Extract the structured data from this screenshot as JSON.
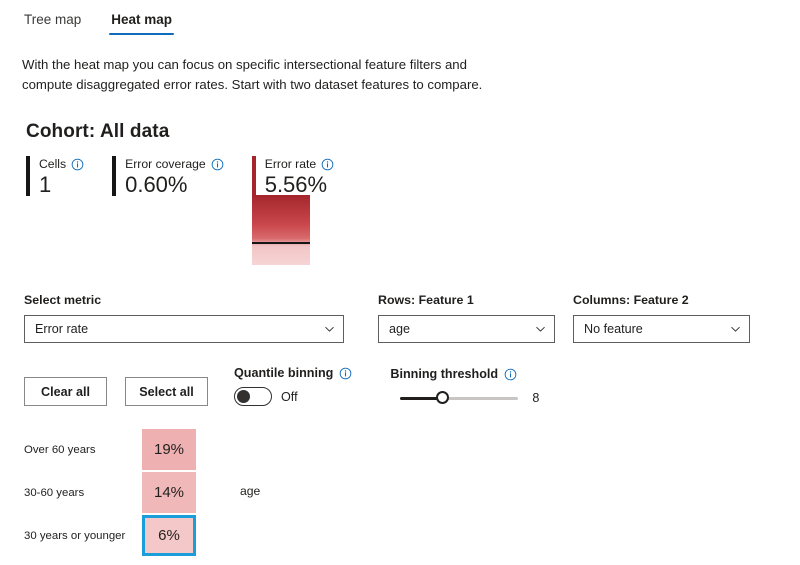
{
  "tabs": [
    {
      "label": "Tree map",
      "active": false
    },
    {
      "label": "Heat map",
      "active": true
    }
  ],
  "description": "With the heat map you can focus on specific intersectional feature filters and compute disaggregated error rates. Start with two dataset features to compare.",
  "cohort": {
    "title": "Cohort: All data",
    "stats": [
      {
        "label": "Cells",
        "value": "1",
        "accent": "#161616",
        "info_icon": "info-icon"
      },
      {
        "label": "Error coverage",
        "value": "0.60%",
        "accent": "#161616",
        "info_icon": "info-icon"
      },
      {
        "label": "Error rate",
        "value": "5.56%",
        "accent": "#a4262c",
        "info_icon": "info-icon"
      }
    ]
  },
  "controls": {
    "metric": {
      "label": "Select metric",
      "value": "Error rate",
      "chevron_icon": "chevron-down-icon"
    },
    "rows": {
      "label": "Rows: Feature 1",
      "value": "age",
      "chevron_icon": "chevron-down-icon"
    },
    "columns": {
      "label": "Columns: Feature 2",
      "value": "No feature",
      "chevron_icon": "chevron-down-icon"
    },
    "clear_all_label": "Clear all",
    "select_all_label": "Select all",
    "quantile_binning": {
      "label": "Quantile binning",
      "state": "Off",
      "info_icon": "info-icon"
    },
    "binning_threshold": {
      "label": "Binning threshold",
      "value": "8",
      "info_icon": "info-icon"
    }
  },
  "heatmap": {
    "axis_label": "age",
    "rows": [
      {
        "label": "Over 60 years",
        "value": "19%",
        "color": "#eeb0b0",
        "selected": false
      },
      {
        "label": "30-60 years",
        "value": "14%",
        "color": "#f0b8b8",
        "selected": false
      },
      {
        "label": "30 years or younger",
        "value": "6%",
        "color": "#f4c8c8",
        "selected": true
      }
    ]
  },
  "colors": {
    "accent_blue": "#0f6cbd",
    "selection_blue": "#1a9ed9",
    "error_red": "#a4262c"
  }
}
